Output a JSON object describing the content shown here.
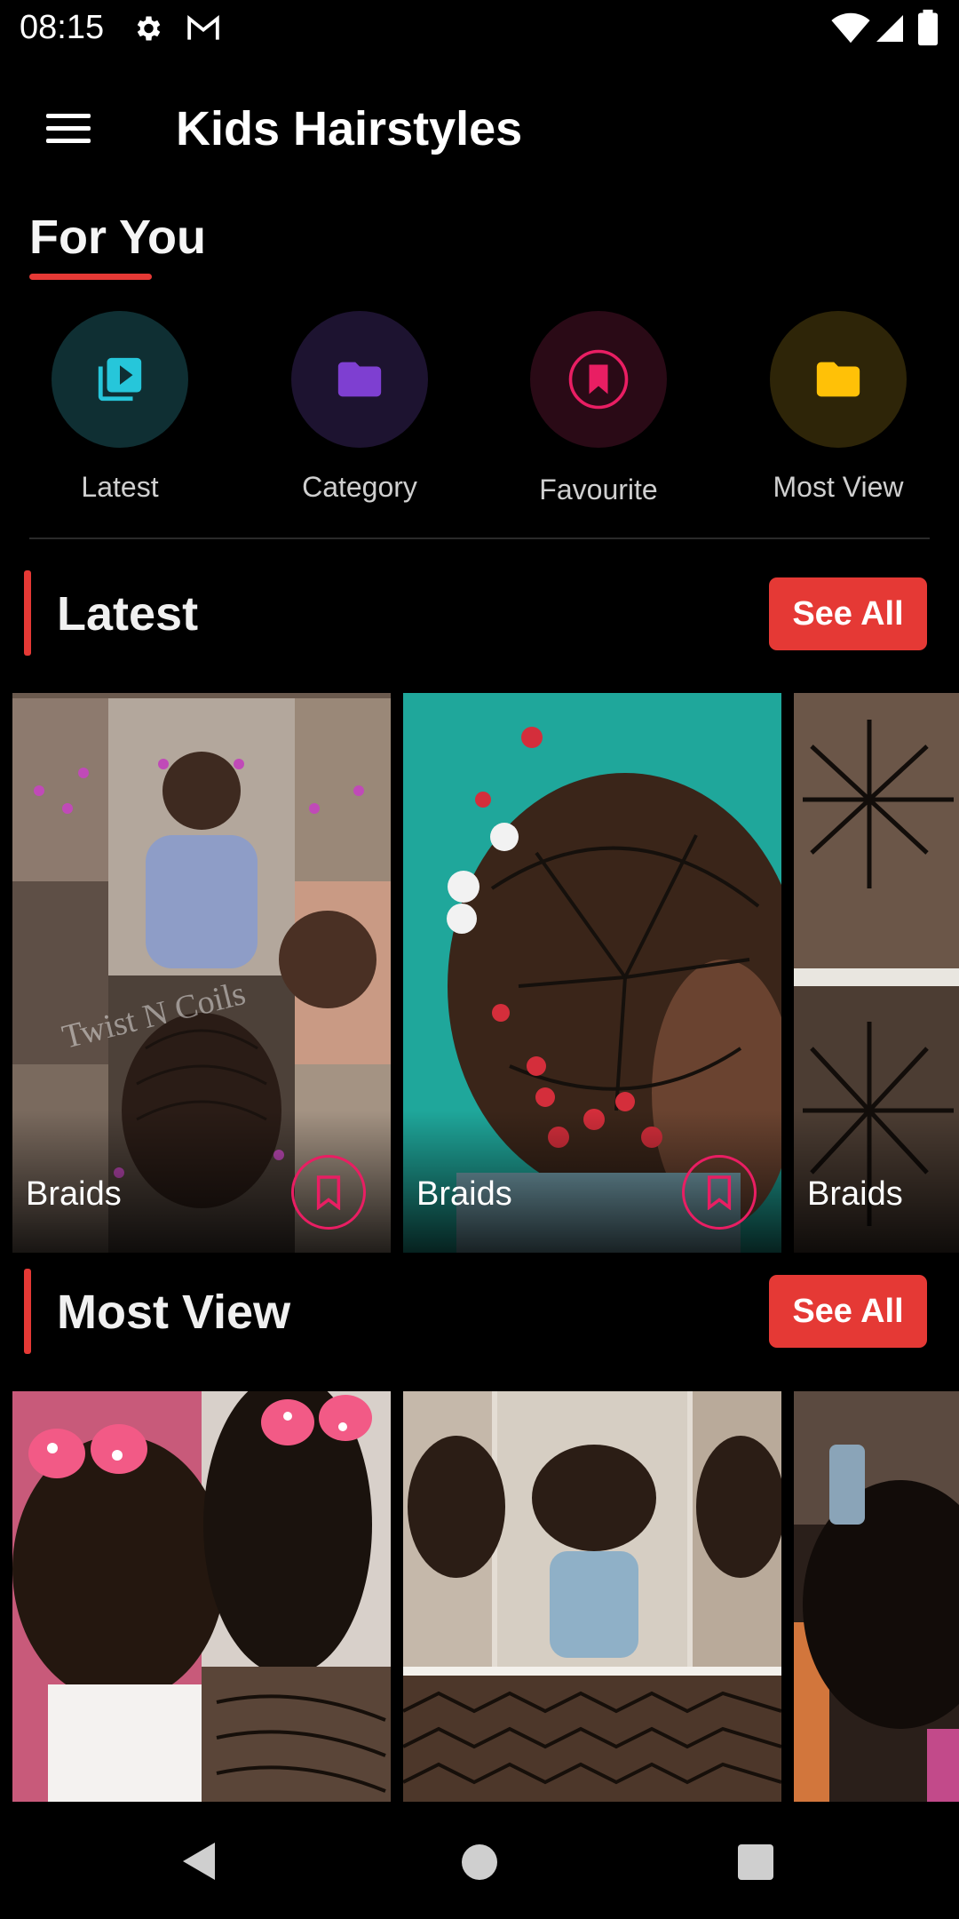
{
  "status_bar": {
    "time": "08:15",
    "icons": [
      "gear-icon",
      "gmail-icon",
      "wifi-icon",
      "signal-icon",
      "battery-icon"
    ]
  },
  "app_bar": {
    "title": "Kids Hairstyles",
    "menu_icon": "hamburger-menu-icon"
  },
  "for_you": {
    "heading": "For You",
    "categories": [
      {
        "label": "Latest",
        "icon": "video-library-icon",
        "color": "#26c6da",
        "bg": "#0f2f33"
      },
      {
        "label": "Category",
        "icon": "folder-icon",
        "color": "#7e3fd1",
        "bg": "#1d1330"
      },
      {
        "label": "Favourite",
        "icon": "bookmark-icon",
        "color": "#e91e63",
        "bg": "#2a0a16"
      },
      {
        "label": "Most View",
        "icon": "folder-icon",
        "color": "#ffc107",
        "bg": "#2e2508"
      }
    ]
  },
  "latest": {
    "title": "Latest",
    "see_all": "See All",
    "cards": [
      {
        "caption": "Braids",
        "watermark": "Twist N Coils"
      },
      {
        "caption": "Braids"
      },
      {
        "caption": "Braids"
      }
    ]
  },
  "most_view": {
    "title": "Most View",
    "see_all": "See All",
    "cards": [
      {},
      {},
      {}
    ]
  },
  "colors": {
    "accent": "#e53935",
    "bookmark": "#e91e63",
    "background": "#000000"
  },
  "nav_bar": {
    "icons": [
      "back-icon",
      "home-icon",
      "recents-icon"
    ]
  }
}
